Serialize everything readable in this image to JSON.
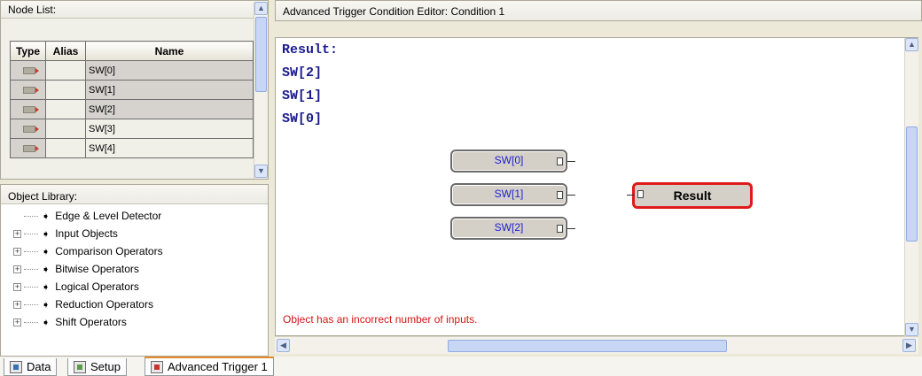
{
  "node_list": {
    "title": "Node List:",
    "columns": [
      "Type",
      "Alias",
      "Name"
    ],
    "rows": [
      {
        "alias": "",
        "name": "SW[0]",
        "selected": true
      },
      {
        "alias": "",
        "name": "SW[1]",
        "selected": true
      },
      {
        "alias": "",
        "name": "SW[2]",
        "selected": true
      },
      {
        "alias": "",
        "name": "SW[3]",
        "selected": false
      },
      {
        "alias": "",
        "name": "SW[4]",
        "selected": false
      }
    ],
    "type_icon": "input-pin-icon"
  },
  "object_library": {
    "title": "Object Library:",
    "items": [
      {
        "label": "Edge & Level Detector",
        "expandable": false
      },
      {
        "label": "Input Objects",
        "expandable": true
      },
      {
        "label": "Comparison Operators",
        "expandable": true
      },
      {
        "label": "Bitwise Operators",
        "expandable": true
      },
      {
        "label": "Logical Operators",
        "expandable": true
      },
      {
        "label": "Reduction Operators",
        "expandable": true
      },
      {
        "label": "Shift Operators",
        "expandable": true
      }
    ]
  },
  "editor": {
    "title": "Advanced Trigger Condition Editor: Condition 1",
    "result_lines": [
      "Result:",
      "SW[2]",
      "SW[1]",
      "SW[0]"
    ],
    "nodes": [
      "SW[0]",
      "SW[1]",
      "SW[2]"
    ],
    "result_node": "Result",
    "error_message": "Object has an incorrect number of inputs."
  },
  "tabs": [
    {
      "label": "Data",
      "icon": "data-icon"
    },
    {
      "label": "Setup",
      "icon": "setup-icon"
    },
    {
      "label": "Advanced Trigger 1",
      "icon": "advanced-trigger-icon"
    }
  ],
  "colors": {
    "result_border": "#e01a1a",
    "error_text": "#d41414",
    "expression_text": "#1a1a8c"
  }
}
